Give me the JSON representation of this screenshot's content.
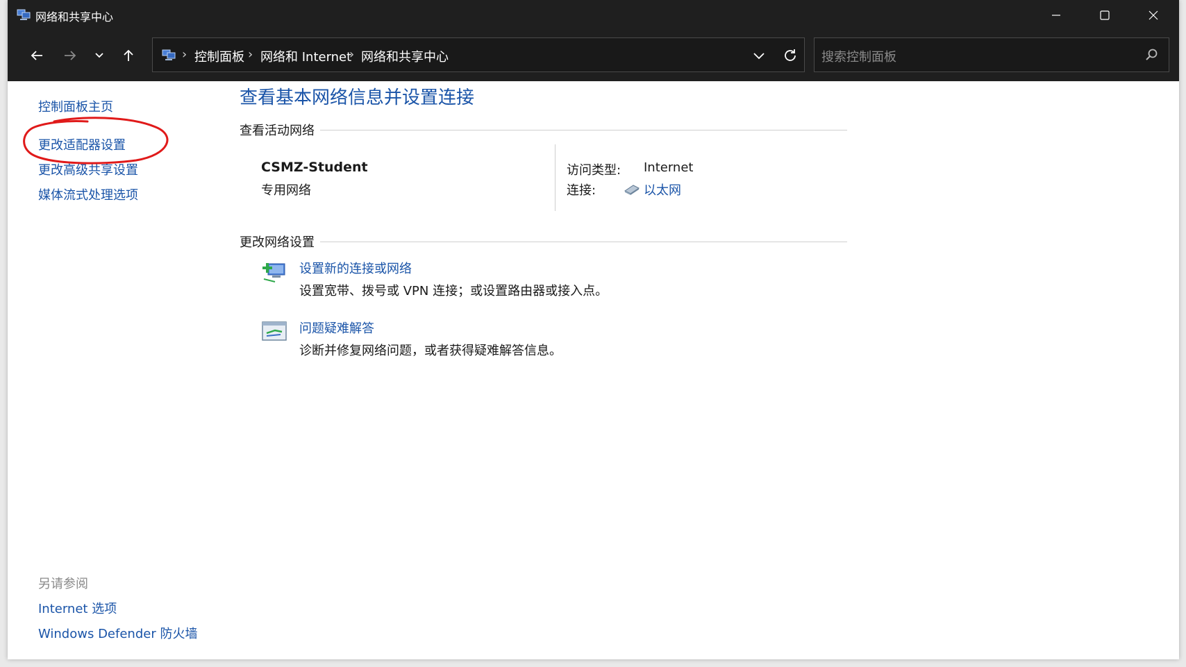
{
  "window": {
    "title": "网络和共享中心",
    "controls": {
      "minimize": "minimize-icon",
      "maximize": "maximize-icon",
      "close": "close-icon"
    }
  },
  "navigation": {
    "breadcrumbs": [
      "控制面板",
      "网络和 Internet",
      "网络和共享中心"
    ],
    "separator": "›",
    "search": {
      "placeholder": "搜索控制面板"
    }
  },
  "sidebar": {
    "links": [
      "控制面板主页",
      "更改适配器设置",
      "更改高级共享设置",
      "媒体流式处理选项"
    ],
    "highlighted": "更改适配器设置",
    "see_also": {
      "heading": "另请参阅",
      "links": [
        "Internet 选项",
        "Windows Defender 防火墙"
      ]
    }
  },
  "main": {
    "title": "查看基本网络信息并设置连接",
    "active_networks": {
      "heading": "查看活动网络",
      "network_name": "CSMZ-Student",
      "network_category": "专用网络",
      "access_type_label": "访问类型:",
      "access_type_value": "Internet",
      "connection_label": "连接:",
      "connection_value": "以太网"
    },
    "change_settings": {
      "heading": "更改网络设置",
      "tasks": [
        {
          "link": "设置新的连接或网络",
          "desc": "设置宽带、拨号或 VPN 连接；或设置路由器或接入点。",
          "icon": "new-connection-icon"
        },
        {
          "link": "问题疑难解答",
          "desc": "诊断并修复网络问题，或者获得疑难解答信息。",
          "icon": "troubleshoot-icon"
        }
      ]
    }
  },
  "colors": {
    "titlebar": "#1f1f1f",
    "link": "#1a54a8",
    "annotation": "#e01a1a"
  }
}
